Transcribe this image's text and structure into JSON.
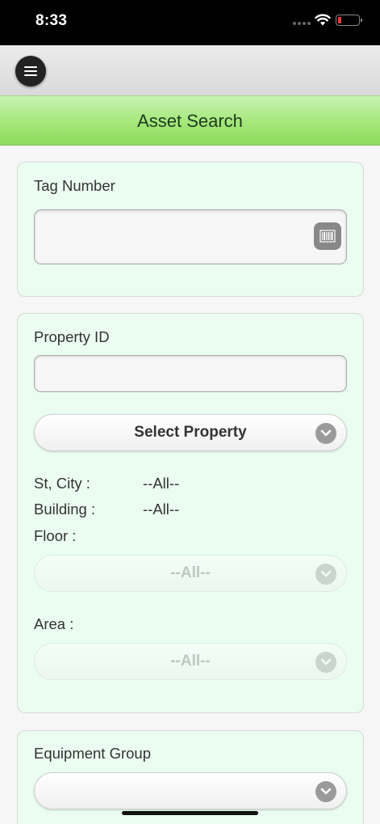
{
  "status": {
    "time": "8:33"
  },
  "header": {
    "title": "Asset Search"
  },
  "tag_section": {
    "label": "Tag Number",
    "value": "",
    "placeholder": ""
  },
  "property_section": {
    "label": "Property ID",
    "value": "",
    "select_label": "Select Property",
    "st_city_label": "St, City :",
    "st_city_value": "--All--",
    "building_label": "Building :",
    "building_value": "--All--",
    "floor_label": "Floor :",
    "floor_value": "--All--",
    "area_label": "Area :",
    "area_value": "--All--"
  },
  "equipment_section": {
    "label": "Equipment Group",
    "value": ""
  },
  "colors": {
    "accent_green": "#a4e77a",
    "card_bg": "#ebfdf1",
    "status_bar": "#000000",
    "battery_low": "#ff3b30"
  },
  "icons": [
    "wifi-icon",
    "battery-icon",
    "menu-icon",
    "barcode-icon",
    "chevron-down-icon"
  ]
}
